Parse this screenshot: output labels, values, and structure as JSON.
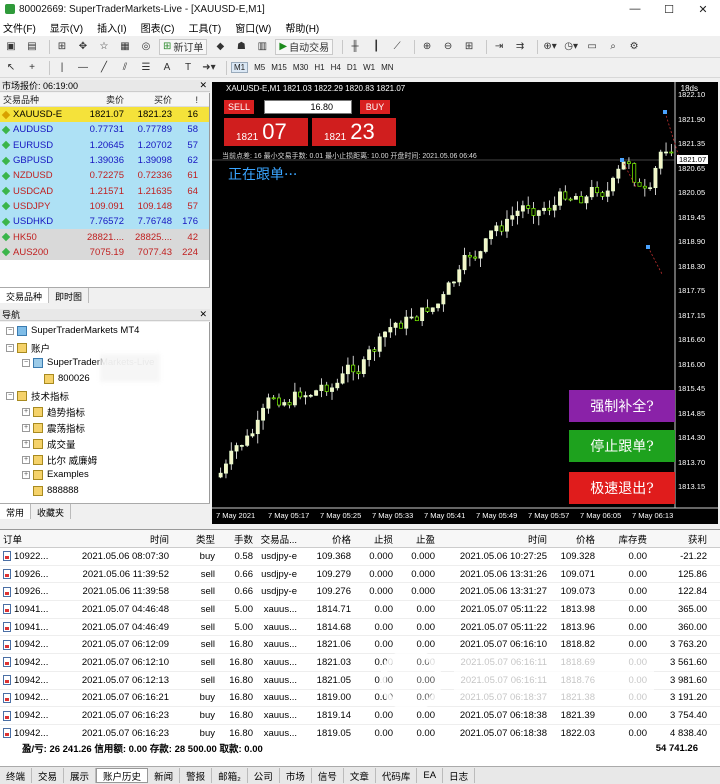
{
  "window": {
    "title": "80002669: SuperTraderMarkets-Live - [XAUUSD-E,M1]",
    "controls": [
      "—",
      "☐",
      "✕"
    ]
  },
  "menu": [
    "文件(F)",
    "显示(V)",
    "插入(I)",
    "图表(C)",
    "工具(T)",
    "窗口(W)",
    "帮助(H)"
  ],
  "toolbar": {
    "new_order": "新订单",
    "auto_trading": "自动交易",
    "timeframes": [
      "M1",
      "M5",
      "M15",
      "M30",
      "H1",
      "H4",
      "D1",
      "W1",
      "MN"
    ],
    "active_timeframe": "M1"
  },
  "market_watch": {
    "header": "市场报价: 06:19:00",
    "columns": [
      "交易品种",
      "卖价",
      "买价",
      "!"
    ],
    "rows": [
      {
        "symbol": "XAUUSD-E",
        "bid": "1821.07",
        "ask": "1821.23",
        "spread": "16",
        "bg": "#f5e23a",
        "color": "#000000",
        "icon": "#d8a000"
      },
      {
        "symbol": "AUDUSD",
        "bid": "0.77731",
        "ask": "0.77789",
        "spread": "58",
        "bg": "#aee1f5",
        "color": "#1515c0",
        "icon": "#3bb54a"
      },
      {
        "symbol": "EURUSD",
        "bid": "1.20645",
        "ask": "1.20702",
        "spread": "57",
        "bg": "#aee1f5",
        "color": "#1515c0",
        "icon": "#3bb54a"
      },
      {
        "symbol": "GBPUSD",
        "bid": "1.39036",
        "ask": "1.39098",
        "spread": "62",
        "bg": "#aee1f5",
        "color": "#1515c0",
        "icon": "#3bb54a"
      },
      {
        "symbol": "NZDUSD",
        "bid": "0.72275",
        "ask": "0.72336",
        "spread": "61",
        "bg": "#aee1f5",
        "color": "#c02020",
        "icon": "#3bb54a"
      },
      {
        "symbol": "USDCAD",
        "bid": "1.21571",
        "ask": "1.21635",
        "spread": "64",
        "bg": "#aee1f5",
        "color": "#c02020",
        "icon": "#3bb54a"
      },
      {
        "symbol": "USDJPY",
        "bid": "109.091",
        "ask": "109.148",
        "spread": "57",
        "bg": "#aee1f5",
        "color": "#c02020",
        "icon": "#3bb54a"
      },
      {
        "symbol": "USDHKD",
        "bid": "7.76572",
        "ask": "7.76748",
        "spread": "176",
        "bg": "#aee1f5",
        "color": "#1515c0",
        "icon": "#3bb54a"
      },
      {
        "symbol": "HK50",
        "bid": "28821....",
        "ask": "28825....",
        "spread": "42",
        "bg": "#d9d9d9",
        "color": "#c02020",
        "icon": "#3bb54a"
      },
      {
        "symbol": "AUS200",
        "bid": "7075.19",
        "ask": "7077.43",
        "spread": "224",
        "bg": "#d9d9d9",
        "color": "#c02020",
        "icon": "#3bb54a"
      }
    ],
    "tabs": [
      "交易品种",
      "即时图"
    ]
  },
  "navigator": {
    "header": "导航",
    "items": [
      {
        "label": "SuperTraderMarkets MT4",
        "indent": 0
      },
      {
        "label": "账户",
        "indent": 1
      },
      {
        "label": "SuperTraderMarkets-Live",
        "indent": 2
      },
      {
        "label": "800026",
        "indent": 3
      },
      {
        "label": "技术指标",
        "indent": 1
      },
      {
        "label": "趋势指标",
        "indent": 2
      },
      {
        "label": "震荡指标",
        "indent": 2
      },
      {
        "label": "成交量",
        "indent": 2
      },
      {
        "label": "比尔 威廉姆",
        "indent": 2
      },
      {
        "label": "Examples",
        "indent": 2
      },
      {
        "label": "888888",
        "indent": 2
      }
    ],
    "tabs": [
      "常用",
      "收藏夹"
    ]
  },
  "chart": {
    "symbol_title": "XAUUSD-E,M1  1821.03 1822.29 1820.83 1821.07",
    "right_label": "18ds",
    "sell_label": "SELL",
    "buy_label": "BUY",
    "lot": "16.80",
    "sell_price_small": "1821",
    "sell_price_big": "07",
    "buy_price_small": "1821",
    "buy_price_big": "23",
    "info_line": "当前点差: 16    最小交易手数: 0.01    最小止损距离: 10.00    开盘时间: 2021.05.06 06:46",
    "following_text": "正在跟单···",
    "current_price": "1821.07",
    "buttons": [
      {
        "label": "强制补全?",
        "color": "#8a22a8"
      },
      {
        "label": "停止跟单?",
        "color": "#1ea21e"
      },
      {
        "label": "极速退出?",
        "color": "#e01c1c"
      }
    ],
    "price_labels": [
      "1822.10",
      "1821.90",
      "1821.35",
      "1820.65",
      "1820.05",
      "1819.45",
      "1818.90",
      "1818.30",
      "1817.75",
      "1817.15",
      "1816.60",
      "1816.00",
      "1815.45",
      "1814.85",
      "1814.30",
      "1813.70",
      "1813.15"
    ],
    "time_labels": [
      "7 May 2021",
      "7 May 05:17",
      "7 May 05:25",
      "7 May 05:33",
      "7 May 05:41",
      "7 May 05:49",
      "7 May 05:57",
      "7 May 06:05",
      "7 May 06:13"
    ]
  },
  "terminal": {
    "columns": [
      "订单",
      "/",
      "时间",
      "类型",
      "手数",
      "交易品...",
      "价格",
      "止损",
      "止盈",
      "时间",
      "价格",
      "库存费",
      "获利"
    ],
    "rows": [
      [
        "10922...",
        "2021.05.06 08:07:30",
        "buy",
        "0.58",
        "usdjpy-e",
        "109.368",
        "0.000",
        "0.000",
        "2021.05.06 10:27:25",
        "109.328",
        "0.00",
        "-21.22"
      ],
      [
        "10926...",
        "2021.05.06 11:39:52",
        "sell",
        "0.66",
        "usdjpy-e",
        "109.279",
        "0.000",
        "0.000",
        "2021.05.06 13:31:26",
        "109.071",
        "0.00",
        "125.86"
      ],
      [
        "10926...",
        "2021.05.06 11:39:58",
        "sell",
        "0.66",
        "usdjpy-e",
        "109.276",
        "0.000",
        "0.000",
        "2021.05.06 13:31:27",
        "109.073",
        "0.00",
        "122.84"
      ],
      [
        "10941...",
        "2021.05.07 04:46:48",
        "sell",
        "5.00",
        "xauus...",
        "1814.71",
        "0.00",
        "0.00",
        "2021.05.07 05:11:22",
        "1813.98",
        "0.00",
        "365.00"
      ],
      [
        "10941...",
        "2021.05.07 04:46:49",
        "sell",
        "5.00",
        "xauus...",
        "1814.68",
        "0.00",
        "0.00",
        "2021.05.07 05:11:22",
        "1813.96",
        "0.00",
        "360.00"
      ],
      [
        "10942...",
        "2021.05.07 06:12:09",
        "sell",
        "16.80",
        "xauus...",
        "1821.06",
        "0.00",
        "0.00",
        "2021.05.07 06:16:10",
        "1818.82",
        "0.00",
        "3 763.20"
      ],
      [
        "10942...",
        "2021.05.07 06:12:10",
        "sell",
        "16.80",
        "xauus...",
        "1821.03",
        "0.00",
        "0.00",
        "2021.05.07 06:16:11",
        "1818.69",
        "0.00",
        "3 561.60"
      ],
      [
        "10942...",
        "2021.05.07 06:12:13",
        "sell",
        "16.80",
        "xauus...",
        "1821.05",
        "0.00",
        "0.00",
        "2021.05.07 06:16:11",
        "1818.76",
        "0.00",
        "3 981.60"
      ],
      [
        "10942...",
        "2021.05.07 06:16:21",
        "buy",
        "16.80",
        "xauus...",
        "1819.00",
        "0.00",
        "0.00",
        "2021.05.07 06:18:37",
        "1821.38",
        "0.00",
        "3 191.20"
      ],
      [
        "10942...",
        "2021.05.07 06:16:23",
        "buy",
        "16.80",
        "xauus...",
        "1819.14",
        "0.00",
        "0.00",
        "2021.05.07 06:18:38",
        "1821.39",
        "0.00",
        "3 754.40"
      ],
      [
        "10942...",
        "2021.05.07 06:16:23",
        "buy",
        "16.80",
        "xauus...",
        "1819.05",
        "0.00",
        "0.00",
        "2021.05.07 06:18:38",
        "1822.03",
        "0.00",
        "4 838.40"
      ]
    ],
    "summary": "盈/亏: 26 241.26  信用额: 0.00  存款: 28 500.00  取款: 0.00",
    "total": "54 741.26",
    "tabs": [
      "交易",
      "展示",
      "账户历史",
      "新闻",
      "警报",
      "邮箱₂",
      "公司",
      "市场",
      "信号",
      "文章",
      "代码库",
      "EA",
      "日志"
    ],
    "active_tab": "账户历史",
    "side_label": "终端"
  }
}
